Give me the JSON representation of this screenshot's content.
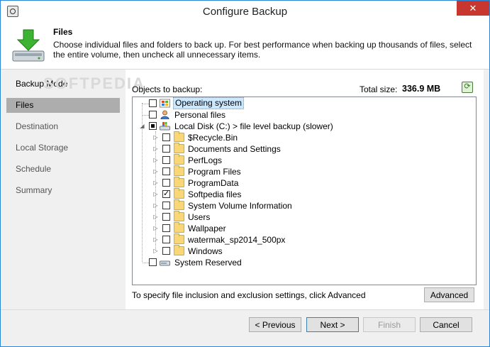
{
  "window": {
    "title": "Configure Backup",
    "close_glyph": "✕"
  },
  "header": {
    "title": "Files",
    "description": "Choose individual files and folders to back up. For best performance when backing up thousands of files, select the entire volume, then uncheck all unnecessary items."
  },
  "watermark": "SOFTPEDIA",
  "sidebar": {
    "items": [
      {
        "label": "Backup Mode"
      },
      {
        "label": "Files"
      },
      {
        "label": "Destination"
      },
      {
        "label": "Local Storage"
      },
      {
        "label": "Schedule"
      },
      {
        "label": "Summary"
      }
    ]
  },
  "objects": {
    "label": "Objects to backup:",
    "total_label": "Total size:",
    "total_value": "336.9 MB"
  },
  "tree": {
    "items": [
      {
        "label": "Operating system",
        "checked": false,
        "selected": true,
        "icon": "os-icon"
      },
      {
        "label": "Personal files",
        "checked": false,
        "icon": "user-icon"
      },
      {
        "label": "Local Disk (C:)    > file level backup (slower)",
        "checked": "partial",
        "icon": "drive-icon"
      },
      {
        "label": "$Recycle.Bin",
        "checked": false,
        "icon": "folder-icon"
      },
      {
        "label": "Documents and Settings",
        "checked": false,
        "icon": "folder-icon"
      },
      {
        "label": "PerfLogs",
        "checked": false,
        "icon": "folder-icon"
      },
      {
        "label": "Program Files",
        "checked": false,
        "icon": "folder-icon"
      },
      {
        "label": "ProgramData",
        "checked": false,
        "icon": "folder-icon"
      },
      {
        "label": "Softpedia files",
        "checked": true,
        "icon": "folder-icon"
      },
      {
        "label": "System Volume Information",
        "checked": false,
        "icon": "folder-icon"
      },
      {
        "label": "Users",
        "checked": false,
        "icon": "folder-icon"
      },
      {
        "label": "Wallpaper",
        "checked": false,
        "icon": "folder-icon"
      },
      {
        "label": "watermak_sp2014_500px",
        "checked": false,
        "icon": "folder-icon"
      },
      {
        "label": "Windows",
        "checked": false,
        "icon": "folder-icon"
      },
      {
        "label": "System Reserved",
        "checked": false,
        "icon": "drive-icon"
      }
    ]
  },
  "hint": "To specify file inclusion and exclusion settings, click Advanced",
  "buttons": {
    "advanced": "Advanced",
    "previous": "< Previous",
    "next": "Next >",
    "finish": "Finish",
    "cancel": "Cancel"
  },
  "colors": {
    "accent": "#2a86d8",
    "close": "#c7372f",
    "nav_active": "#adadad"
  }
}
